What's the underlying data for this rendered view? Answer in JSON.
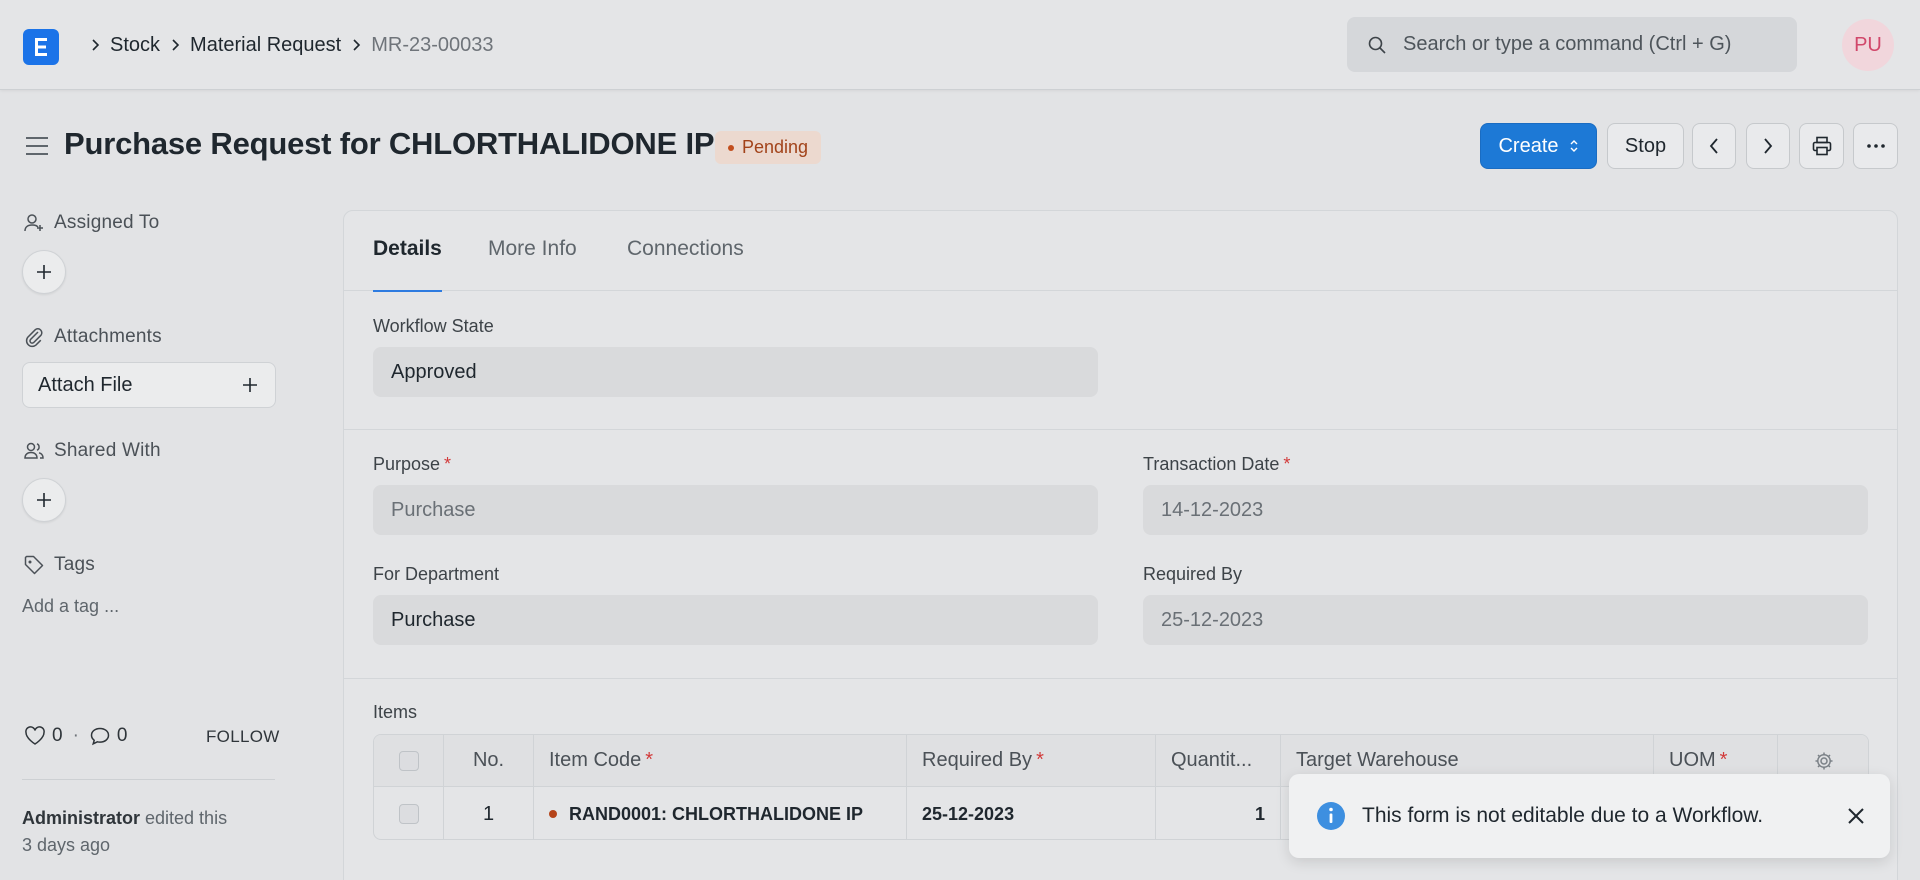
{
  "navbar": {
    "logo_letter": "E",
    "breadcrumbs": [
      "Stock",
      "Material Request",
      "MR-23-00033"
    ],
    "search_placeholder": "Search or type a command (Ctrl + G)",
    "avatar_initials": "PU"
  },
  "page": {
    "title": "Purchase Request for CHLORTHALIDONE IP",
    "status": "Pending",
    "buttons": {
      "create": "Create",
      "stop": "Stop"
    }
  },
  "sidebar": {
    "assigned_to": "Assigned To",
    "attachments": "Attachments",
    "attach_file": "Attach File",
    "shared_with": "Shared With",
    "tags": "Tags",
    "add_tag": "Add a tag ...",
    "likes": "0",
    "comments": "0",
    "follow": "FOLLOW",
    "activity_user": "Administrator",
    "activity_text": " edited this",
    "activity_time": "3 days ago"
  },
  "tabs": [
    "Details",
    "More Info",
    "Connections"
  ],
  "form": {
    "workflow_state": {
      "label": "Workflow State",
      "value": "Approved"
    },
    "purpose": {
      "label": "Purpose",
      "value": "Purchase"
    },
    "transaction_date": {
      "label": "Transaction Date",
      "value": "14-12-2023"
    },
    "for_department": {
      "label": "For Department",
      "value": "Purchase"
    },
    "required_by": {
      "label": "Required By",
      "value": "25-12-2023"
    }
  },
  "items": {
    "label": "Items",
    "columns": {
      "no": "No.",
      "item_code": "Item Code",
      "required_by": "Required By",
      "quantity": "Quantit...",
      "target_warehouse": "Target Warehouse",
      "uom": "UOM"
    },
    "rows": [
      {
        "no": "1",
        "item_code": "RAND0001: CHLORTHALIDONE IP",
        "required_by": "25-12-2023",
        "quantity": "1"
      }
    ]
  },
  "toast": {
    "message": "This form is not editable due to a Workflow."
  },
  "colors": {
    "primary": "#1d79d6",
    "pending": "#a2431a",
    "required": "#d23a3a"
  }
}
